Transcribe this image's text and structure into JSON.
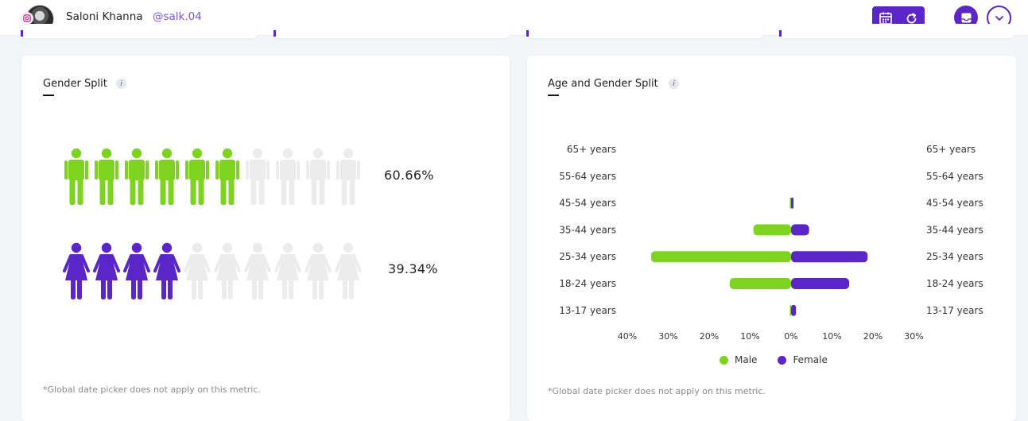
{
  "header": {
    "user_name": "Saloni Khanna",
    "user_handle": "@salk.04"
  },
  "colors": {
    "accent": "#5a26c8",
    "male": "#7ed321",
    "female": "#5a26c8",
    "inactive": "#ececec"
  },
  "icons": {
    "platform": "instagram-icon",
    "date_picker": "calendar-icon",
    "refresh": "refresh-icon",
    "inbox": "inbox-icon",
    "menu": "chevron-down-icon",
    "info": "info-icon"
  },
  "gender_split": {
    "title": "Gender Split",
    "info": "i",
    "male_percent": "60.66%",
    "female_percent": "39.34%",
    "male_icons_filled": 6,
    "female_icons_filled": 4,
    "icons_total": 10,
    "footnote": "*Global date picker does not apply on this metric."
  },
  "age_gender_split": {
    "title": "Age and Gender Split",
    "info": "i",
    "footnote": "*Global date picker does not apply on this metric.",
    "legend": {
      "male": "Male",
      "female": "Female"
    }
  },
  "chart_data": {
    "type": "bar",
    "orientation": "horizontal-diverging",
    "categories": [
      "65+ years",
      "55-64 years",
      "45-54 years",
      "35-44 years",
      "25-34 years",
      "18-24 years",
      "13-17 years"
    ],
    "series": [
      {
        "name": "Male",
        "values": [
          0,
          0,
          0.3,
          9.2,
          34.2,
          15.0,
          0.3
        ]
      },
      {
        "name": "Female",
        "values": [
          0,
          0,
          0.6,
          4.4,
          18.7,
          14.2,
          1.2
        ]
      }
    ],
    "x_ticks_left": [
      "40%",
      "30%",
      "20%",
      "10%",
      "0%"
    ],
    "x_ticks_right": [
      "10%",
      "20%",
      "30%"
    ],
    "xlim_male": [
      0,
      40
    ],
    "xlim_female": [
      0,
      30
    ],
    "legend_position": "bottom"
  }
}
